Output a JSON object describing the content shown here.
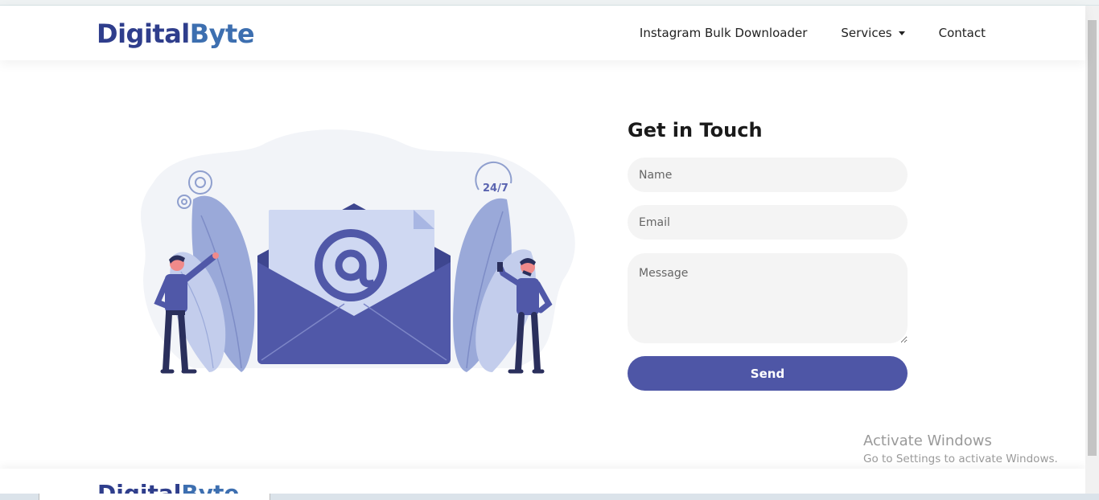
{
  "brand": {
    "logo_part1": "Digital",
    "logo_part2": "Byte"
  },
  "nav": {
    "items": [
      {
        "label": "Instagram Bulk Downloader"
      },
      {
        "label": "Services"
      },
      {
        "label": "Contact"
      }
    ]
  },
  "illustration": {
    "badge_text": "24/7"
  },
  "contact": {
    "title": "Get in Touch",
    "name_placeholder": "Name",
    "email_placeholder": "Email",
    "message_placeholder": "Message",
    "send_label": "Send"
  },
  "watermark": {
    "title": "Activate Windows",
    "subtitle": "Go to Settings to activate Windows."
  },
  "colors": {
    "primary": "#4e56a6",
    "accent_light": "#9aa9d9",
    "logo_dark": "#2f3e8c",
    "logo_light": "#3d6fb0"
  }
}
